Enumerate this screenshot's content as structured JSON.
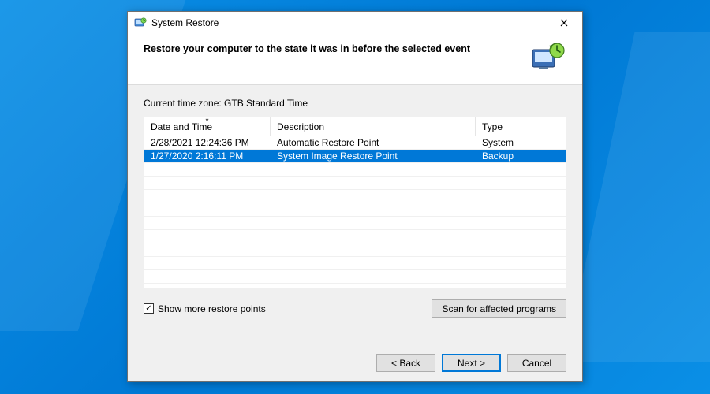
{
  "window": {
    "title": "System Restore"
  },
  "header": {
    "heading": "Restore your computer to the state it was in before the selected event"
  },
  "timezone_label": "Current time zone: GTB Standard Time",
  "table": {
    "columns": {
      "date_time": "Date and Time",
      "description": "Description",
      "type": "Type"
    },
    "rows": [
      {
        "date_time": "2/28/2021 12:24:36 PM",
        "description": "Automatic Restore Point",
        "type": "System",
        "selected": false
      },
      {
        "date_time": "1/27/2020 2:16:11 PM",
        "description": "System Image Restore Point",
        "type": "Backup",
        "selected": true
      }
    ]
  },
  "checkbox": {
    "label": "Show more restore points",
    "checked": true
  },
  "buttons": {
    "scan": "Scan for affected programs",
    "back": "< Back",
    "next": "Next >",
    "cancel": "Cancel"
  }
}
